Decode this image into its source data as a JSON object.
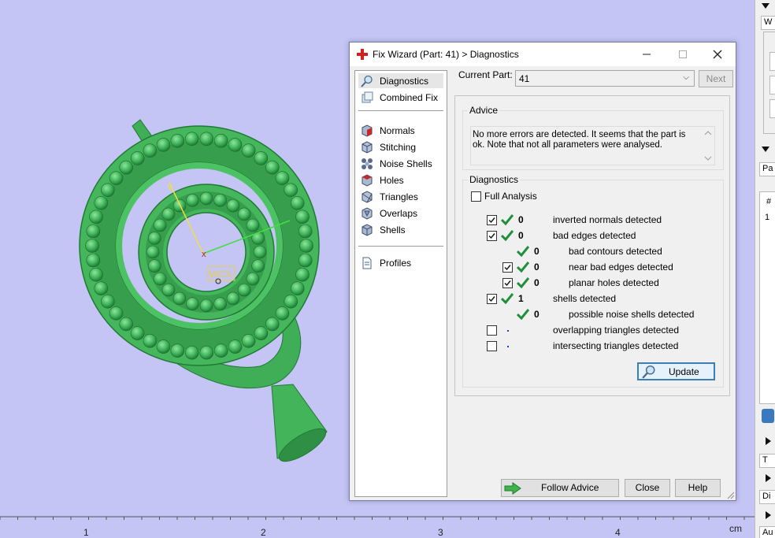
{
  "viewport": {
    "background": "#c4c4f5",
    "wcs_label": "WCS",
    "ruler": {
      "unit": "cm",
      "ticks": [
        "1",
        "2",
        "3",
        "4"
      ]
    }
  },
  "dialog": {
    "title": "Fix Wizard (Part: 41) > Diagnostics",
    "title_icon": "red-cross-icon",
    "nav": {
      "items": [
        {
          "label": "Diagnostics",
          "icon": "magnifier-icon",
          "selected": true
        },
        {
          "label": "Combined Fix",
          "icon": "combined-fix-icon"
        },
        {
          "label": "Normals",
          "icon": "normals-cube-icon"
        },
        {
          "label": "Stitching",
          "icon": "stitching-cube-icon"
        },
        {
          "label": "Noise Shells",
          "icon": "noise-shells-icon"
        },
        {
          "label": "Holes",
          "icon": "holes-cube-icon"
        },
        {
          "label": "Triangles",
          "icon": "triangles-cube-icon"
        },
        {
          "label": "Overlaps",
          "icon": "overlaps-cube-icon"
        },
        {
          "label": "Shells",
          "icon": "shells-cube-icon"
        },
        {
          "label": "Profiles",
          "icon": "document-icon"
        }
      ]
    },
    "current_part": {
      "label": "Current Part:",
      "value": "41"
    },
    "next_label": "Next",
    "advice": {
      "title": "Advice",
      "text": "No more errors are detected. It seems that the part is ok. Note that not all parameters were analysed."
    },
    "diagnostics": {
      "title": "Diagnostics",
      "full_analysis_label": "Full Analysis",
      "rows": [
        {
          "label": "inverted normals detected",
          "count": "0",
          "checkbox": true,
          "checked": true,
          "status": "ok",
          "indent": 0
        },
        {
          "label": "bad edges detected",
          "count": "0",
          "checkbox": true,
          "checked": true,
          "status": "ok",
          "indent": 0
        },
        {
          "label": "bad contours detected",
          "count": "0",
          "checkbox": false,
          "status": "ok",
          "indent": 1
        },
        {
          "label": "near bad edges detected",
          "count": "0",
          "checkbox": true,
          "checked": true,
          "status": "ok",
          "indent": 1
        },
        {
          "label": "planar holes detected",
          "count": "0",
          "checkbox": true,
          "checked": true,
          "status": "ok",
          "indent": 1
        },
        {
          "label": "shells detected",
          "count": "1",
          "checkbox": true,
          "checked": true,
          "status": "ok",
          "indent": 0
        },
        {
          "label": "possible noise shells detected",
          "count": "0",
          "checkbox": false,
          "status": "ok",
          "indent": 1
        },
        {
          "label": "overlapping triangles detected",
          "count": "",
          "checkbox": true,
          "checked": false,
          "status": "not-analysed",
          "indent": 0
        },
        {
          "label": "intersecting triangles detected",
          "count": "",
          "checkbox": true,
          "checked": false,
          "status": "not-analysed",
          "indent": 0
        }
      ],
      "update_label": "Update"
    },
    "footer": {
      "follow_advice_label": "Follow Advice",
      "close_label": "Close",
      "help_label": "Help"
    },
    "colors": {
      "ok_tick": "#1f8f3a",
      "accent": "#3c7fb1"
    }
  },
  "right_panel": {
    "labels": [
      "W",
      "Pa",
      "#",
      "1",
      "T",
      "Di",
      "Au"
    ]
  }
}
